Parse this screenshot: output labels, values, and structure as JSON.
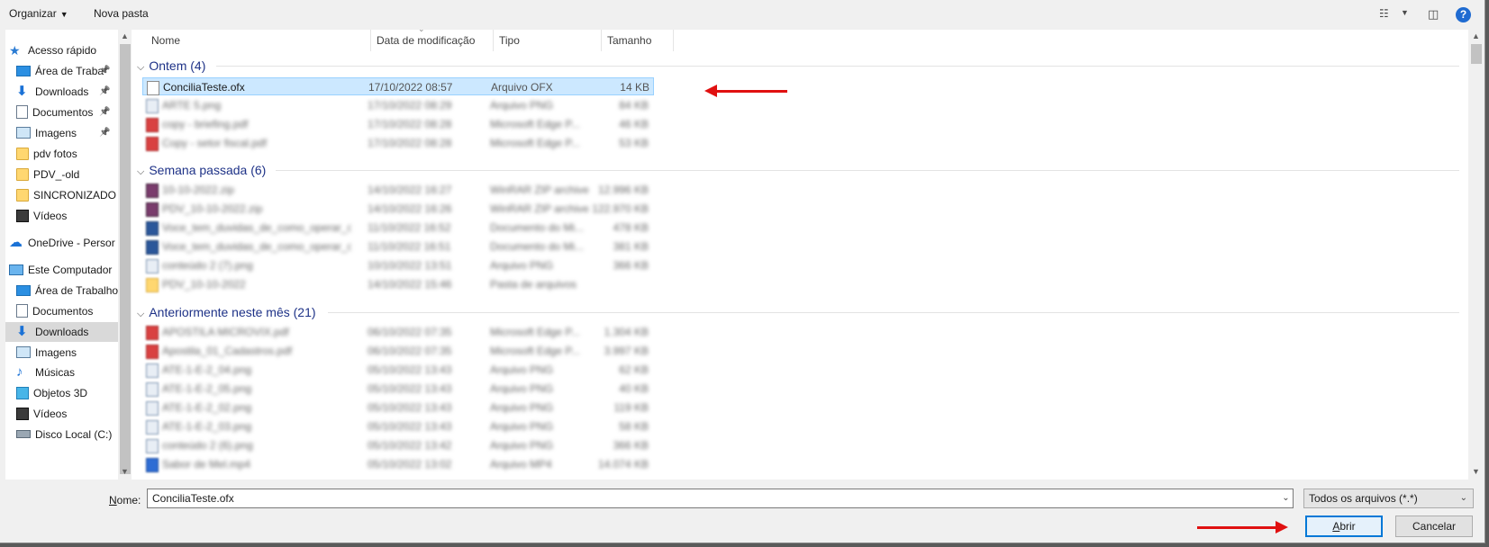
{
  "toolbar": {
    "organize": "Organizar",
    "new_folder": "Nova pasta"
  },
  "nav": {
    "items": [
      {
        "label": "Acesso rápido",
        "icon": "quick-access-star-icon"
      },
      {
        "label": "Área de Traba",
        "icon": "desktop-icon",
        "pinned": true
      },
      {
        "label": "Downloads",
        "icon": "download-arrow-icon",
        "pinned": true
      },
      {
        "label": "Documentos",
        "icon": "documents-icon",
        "pinned": true
      },
      {
        "label": "Imagens",
        "icon": "images-icon",
        "pinned": true
      },
      {
        "label": "pdv fotos",
        "icon": "folder-icon"
      },
      {
        "label": "PDV_-old",
        "icon": "folder-icon"
      },
      {
        "label": "SINCRONIZADO",
        "icon": "folder-icon"
      },
      {
        "label": "Vídeos",
        "icon": "videos-icon"
      },
      {
        "label": "OneDrive - Persor",
        "icon": "onedrive-cloud-icon"
      },
      {
        "label": "Este Computador",
        "icon": "computer-icon"
      },
      {
        "label": "Área de Trabalho",
        "icon": "desktop-icon"
      },
      {
        "label": "Documentos",
        "icon": "documents-icon"
      },
      {
        "label": "Downloads",
        "icon": "download-arrow-icon",
        "selected": true
      },
      {
        "label": "Imagens",
        "icon": "images-icon"
      },
      {
        "label": "Músicas",
        "icon": "music-icon"
      },
      {
        "label": "Objetos 3D",
        "icon": "3d-objects-icon"
      },
      {
        "label": "Vídeos",
        "icon": "videos-icon"
      },
      {
        "label": "Disco Local (C:)",
        "icon": "local-disk-icon"
      }
    ]
  },
  "columns": {
    "name": "Nome",
    "date": "Data de modificação",
    "type": "Tipo",
    "size": "Tamanho"
  },
  "groups": [
    {
      "title": "Ontem (4)",
      "rows": [
        {
          "name": "ConciliaTeste.ofx",
          "date": "17/10/2022 08:57",
          "type": "Arquivo OFX",
          "size": "14 KB",
          "icon": "doc",
          "selected": true,
          "blurred": false
        },
        {
          "name": "ARTE 5.png",
          "date": "17/10/2022 08:29",
          "type": "Arquivo PNG",
          "size": "84 KB",
          "icon": "png",
          "blurred": true
        },
        {
          "name": "copy - briefing.pdf",
          "date": "17/10/2022 08:28",
          "type": "Microsoft Edge P...",
          "size": "46 KB",
          "icon": "pdf",
          "blurred": true
        },
        {
          "name": "Copy - setor fiscal.pdf",
          "date": "17/10/2022 08:28",
          "type": "Microsoft Edge P...",
          "size": "53 KB",
          "icon": "pdf",
          "blurred": true
        }
      ]
    },
    {
      "title": "Semana passada (6)",
      "rows": [
        {
          "name": "10-10-2022.zip",
          "date": "14/10/2022 16:27",
          "type": "WinRAR ZIP archive",
          "size": "12.996 KB",
          "icon": "zip",
          "blurred": true
        },
        {
          "name": "PDV_10-10-2022.zip",
          "date": "14/10/2022 16:26",
          "type": "WinRAR ZIP archive",
          "size": "122.970 KB",
          "icon": "zip",
          "blurred": true
        },
        {
          "name": "Voce_tem_duvidas_de_como_operar_o_s...",
          "date": "11/10/2022 16:52",
          "type": "Documento do Mi...",
          "size": "478 KB",
          "icon": "word",
          "blurred": true
        },
        {
          "name": "Voce_tem_duvidas_de_como_operar_o_s...",
          "date": "11/10/2022 16:51",
          "type": "Documento do Mi...",
          "size": "381 KB",
          "icon": "word",
          "blurred": true
        },
        {
          "name": "conteúdo 2 (7).png",
          "date": "10/10/2022 13:51",
          "type": "Arquivo PNG",
          "size": "366 KB",
          "icon": "png",
          "blurred": true
        },
        {
          "name": "PDV_10-10-2022",
          "date": "14/10/2022 15:46",
          "type": "Pasta de arquivos",
          "size": "",
          "icon": "folder",
          "blurred": true
        }
      ]
    },
    {
      "title": "Anteriormente neste mês (21)",
      "rows": [
        {
          "name": "APOSTILA MICROVIX.pdf",
          "date": "06/10/2022 07:35",
          "type": "Microsoft Edge P...",
          "size": "1.304 KB",
          "icon": "pdf",
          "blurred": true
        },
        {
          "name": "Apostila_01_Cadastros.pdf",
          "date": "06/10/2022 07:35",
          "type": "Microsoft Edge P...",
          "size": "3.997 KB",
          "icon": "pdf",
          "blurred": true
        },
        {
          "name": "ATE-1-E-2_04.png",
          "date": "05/10/2022 13:43",
          "type": "Arquivo PNG",
          "size": "62 KB",
          "icon": "png",
          "blurred": true
        },
        {
          "name": "ATE-1-E-2_05.png",
          "date": "05/10/2022 13:43",
          "type": "Arquivo PNG",
          "size": "40 KB",
          "icon": "png",
          "blurred": true
        },
        {
          "name": "ATE-1-E-2_02.png",
          "date": "05/10/2022 13:43",
          "type": "Arquivo PNG",
          "size": "119 KB",
          "icon": "png",
          "blurred": true
        },
        {
          "name": "ATE-1-E-2_03.png",
          "date": "05/10/2022 13:43",
          "type": "Arquivo PNG",
          "size": "58 KB",
          "icon": "png",
          "blurred": true
        },
        {
          "name": "conteúdo 2 (6).png",
          "date": "05/10/2022 13:42",
          "type": "Arquivo PNG",
          "size": "366 KB",
          "icon": "png",
          "blurred": true
        },
        {
          "name": "Sabor de Mel.mp4",
          "date": "05/10/2022 13:02",
          "type": "Arquivo MP4",
          "size": "14.074 KB",
          "icon": "mp4",
          "blurred": true
        }
      ]
    }
  ],
  "bottom": {
    "name_label_first": "N",
    "name_label_rest": "ome:",
    "filename": "ConciliaTeste.ofx",
    "filetype": "Todos os arquivos (*.*)",
    "open_first": "A",
    "open_rest": "brir",
    "cancel": "Cancelar"
  },
  "colors": {
    "annotation_arrow": "#e01010",
    "selection": "#cce8ff",
    "group_header": "#1e3287"
  }
}
